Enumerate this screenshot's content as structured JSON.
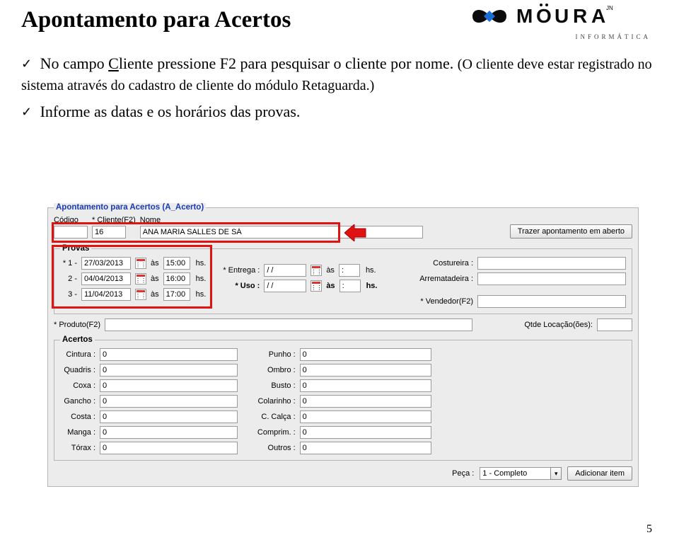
{
  "doc": {
    "title": "Apontamento para Acertos",
    "bullet1_prefix": "No campo ",
    "bullet1_client_word": "Cliente",
    "bullet1_rest": " pressione F2 para pesquisar o cliente por nome. ",
    "note": "(O cliente deve estar registrado no sistema através do cadastro de cliente do módulo Retaguarda.)",
    "bullet2": "Informe as datas e os horários das provas.",
    "logo_text": "MOURA",
    "logo_jn": "JN",
    "logo_sub": "INFORMÁTICA",
    "page_number": "5"
  },
  "form": {
    "legend": "Apontamento para Acertos (A_Acerto)",
    "codigo_label": "Código",
    "cliente_label": "* Cliente(F2)",
    "nome_label": "Nome",
    "cliente_value": "16",
    "nome_value": "ANA MARIA SALLES DE SÁ",
    "trazer_btn": "Trazer apontamento em aberto",
    "provas_legend": "Provas",
    "as_label": "às",
    "hs_label": "hs.",
    "p1_label": "* 1 -",
    "p2_label": "2 -",
    "p3_label": "3 -",
    "p1_date": "27/03/2013",
    "p1_time": "15:00",
    "p2_date": "04/04/2013",
    "p2_time": "16:00",
    "p3_date": "11/04/2013",
    "p3_time": "17:00",
    "entrega_label": "* Entrega :",
    "uso_label": "* Uso :",
    "entrega_date": "/ /",
    "entrega_time": ":",
    "uso_date": "/ /",
    "uso_time": ":",
    "costureira_label": "Costureira :",
    "arrematadeira_label": "Arrematadeira :",
    "vendedor_label": "* Vendedor(F2)",
    "produto_label": "* Produto(F2)",
    "qtde_label": "Qtde Locação(ões):",
    "acertos_legend": "Acertos",
    "fields": {
      "cintura": "Cintura :",
      "cintura_v": "0",
      "quadris": "Quadris :",
      "quadris_v": "0",
      "coxa": "Coxa :",
      "coxa_v": "0",
      "gancho": "Gancho :",
      "gancho_v": "0",
      "costa": "Costa :",
      "costa_v": "0",
      "manga": "Manga :",
      "manga_v": "0",
      "torax": "Tórax :",
      "torax_v": "0",
      "punho": "Punho :",
      "punho_v": "0",
      "ombro": "Ombro :",
      "ombro_v": "0",
      "busto": "Busto :",
      "busto_v": "0",
      "colarinho": "Colarinho :",
      "colarinho_v": "0",
      "ccalca": "C. Calça :",
      "ccalca_v": "0",
      "comprim": "Comprim. :",
      "comprim_v": "0",
      "outros": "Outros :",
      "outros_v": "0"
    },
    "peca_label": "Peça :",
    "peca_value": "1 - Completo",
    "add_item": "Adicionar item"
  }
}
